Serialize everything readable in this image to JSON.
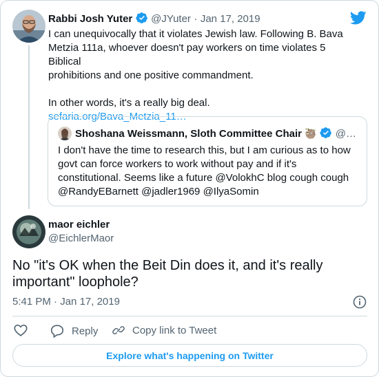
{
  "colors": {
    "accent": "#1d9bf0",
    "text": "#0f1419",
    "secondary": "#536471",
    "border": "#cfd9de"
  },
  "parent_tweet": {
    "author_name": "Rabbi Josh Yuter",
    "handle": "@JYuter",
    "separator": "·",
    "date": "Jan 17, 2019",
    "verified": true,
    "text_lines": [
      "I can unequivocally that it violates Jewish law. Following B. Bava",
      "Metzia 111a, whoever doesn't pay workers on time violates 5 Biblical",
      "prohibitions and one positive commandment."
    ],
    "text_line_2": "In other words, it's a really big deal.",
    "link": "sefaria.org/Bava_Metzia_11…"
  },
  "quoted_tweet": {
    "author_name": "Shoshana Weissmann, Sloth Committee Chair",
    "emoji": "🦥",
    "handle": "@…",
    "verified": true,
    "text_lines": [
      "I don't have the time to research this, but I am curious as to how",
      "govt can force workers to work without pay and if it's",
      "constitutional. Seems like a future @VolokhC blog cough cough",
      "@RandyEBarnett @jadler1969 @IlyaSomin"
    ]
  },
  "main_tweet": {
    "author_name": "maor eichler",
    "handle": "@EichlerMaor",
    "text_lines": [
      "No \"it's OK when the Beit Din does it, and it's really",
      "important\" loophole?"
    ],
    "time": "5:41 PM",
    "separator": "·",
    "date": "Jan 17, 2019"
  },
  "actions": {
    "like_icon": "heart-icon",
    "reply_label": "Reply",
    "copy_label": "Copy link to Tweet"
  },
  "explore_label": "Explore what's happening on Twitter"
}
